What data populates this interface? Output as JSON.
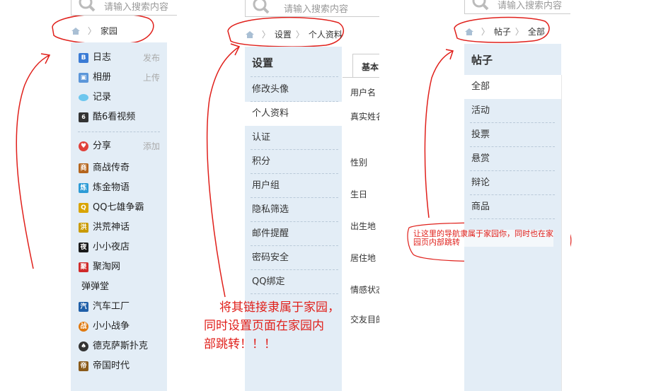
{
  "search": {
    "placeholder": "请输入搜索内容",
    "placeholder_cut": "请输入搜索内容"
  },
  "panel1": {
    "breadcrumb": [
      "家园"
    ],
    "group1": [
      {
        "label": "日志",
        "action": "发布",
        "icon": "blog-icon",
        "color": "#3a7bd5",
        "glyph": "B"
      },
      {
        "label": "相册",
        "action": "上传",
        "icon": "photo-icon",
        "color": "#4a8fd8",
        "glyph": "▣"
      },
      {
        "label": "记录",
        "action": "",
        "icon": "speech-bubble-icon",
        "color": "#5bbde8",
        "glyph": ""
      },
      {
        "label": "酷6看视频",
        "action": "",
        "icon": "video-icon",
        "color": "#333333",
        "glyph": "6"
      }
    ],
    "share": {
      "label": "分享",
      "action": "添加",
      "icon": "heart-icon",
      "color": "#e0403a"
    },
    "apps": [
      {
        "label": "商战传奇",
        "icon": "shop-game-icon",
        "color": "#b5651d"
      },
      {
        "label": "炼金物语",
        "icon": "alchemy-icon",
        "color": "#2c9bd6"
      },
      {
        "label": "QQ七雄争霸",
        "icon": "qq-game-icon",
        "color": "#d9a400"
      },
      {
        "label": "洪荒神话",
        "icon": "myth-game-icon",
        "color": "#c99a00"
      },
      {
        "label": "小小夜店",
        "icon": "night-club-icon",
        "color": "#1a1a1a"
      },
      {
        "label": "聚淘网",
        "icon": "jutao-icon",
        "color": "#d02a2a"
      },
      {
        "label": "弹弹堂",
        "icon": "",
        "color": ""
      },
      {
        "label": "汽车工厂",
        "icon": "car-factory-icon",
        "color": "#1f5fa8"
      },
      {
        "label": "小小战争",
        "icon": "war-game-icon",
        "color": "#e07a10"
      },
      {
        "label": "德克萨斯扑克",
        "icon": "poker-icon",
        "color": "#333333"
      },
      {
        "label": "帝国时代",
        "icon": "empire-icon",
        "color": "#8a5a1a"
      }
    ]
  },
  "panel2": {
    "breadcrumb": [
      "设置",
      "个人资料"
    ],
    "menu_title": "设置",
    "menu": [
      "修改头像",
      "个人资料",
      "认证",
      "积分",
      "用户组",
      "隐私筛选",
      "邮件提醒",
      "密码安全",
      "QQ绑定"
    ],
    "active_index": 1,
    "tab_label": "基本",
    "fields": [
      "用户名",
      "真实姓名",
      "性别",
      "生日",
      "出生地",
      "居住地",
      "情感状态",
      "交友目的"
    ]
  },
  "panel3": {
    "breadcrumb": [
      "帖子",
      "全部"
    ],
    "menu_title": "帖子",
    "menu": [
      "全部",
      "活动",
      "投票",
      "悬赏",
      "辩论",
      "商品"
    ],
    "active_index": 0
  },
  "annotations": {
    "note_middle": [
      "将其链接隶属于家园，",
      "同时设置页面在家园内",
      "部跳转！！！"
    ],
    "note_right": [
      "让这里的导航隶属于家园你，同时也在家",
      "园页内部跳转"
    ]
  },
  "colors": {
    "annotation": "#e0201b",
    "sidebar_bg": "#e3edf6",
    "accent": "#3a7bd5"
  }
}
